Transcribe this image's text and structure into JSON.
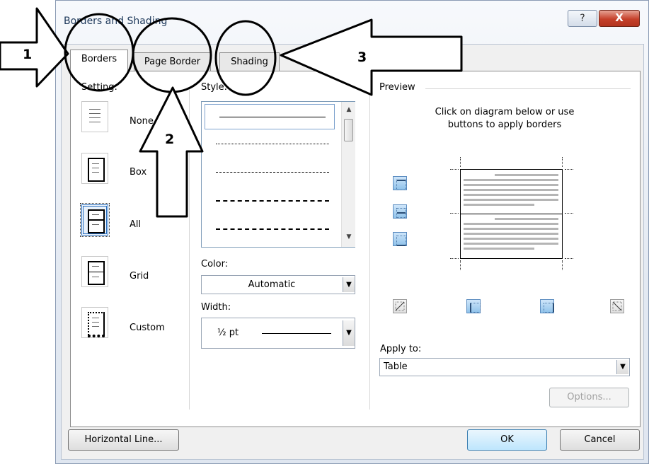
{
  "window": {
    "title": "Borders and Shading",
    "help_label": "?",
    "close_label": "X"
  },
  "tabs": [
    {
      "label": "Borders",
      "active": true
    },
    {
      "label": "Page Border",
      "active": false
    },
    {
      "label": "Shading",
      "active": false
    }
  ],
  "setting": {
    "label": "Setting:",
    "options": [
      {
        "label": "None",
        "selected": false
      },
      {
        "label": "Box",
        "selected": false
      },
      {
        "label": "All",
        "selected": true
      },
      {
        "label": "Grid",
        "selected": false
      },
      {
        "label": "Custom",
        "selected": false
      }
    ]
  },
  "style": {
    "label": "Style:"
  },
  "color": {
    "label": "Color:",
    "value": "Automatic"
  },
  "width": {
    "label": "Width:",
    "value": "½ pt"
  },
  "preview": {
    "label": "Preview",
    "instruction": "Click on diagram below or use buttons to apply borders"
  },
  "apply_to": {
    "label": "Apply to:",
    "value": "Table"
  },
  "buttons": {
    "options": "Options...",
    "horizontal_line": "Horizontal Line...",
    "ok": "OK",
    "cancel": "Cancel"
  },
  "annotations": {
    "one": "1",
    "two": "2",
    "three": "3"
  },
  "colors": {
    "accent_blue": "#2a6fbf",
    "close_red": "#c5402a"
  }
}
